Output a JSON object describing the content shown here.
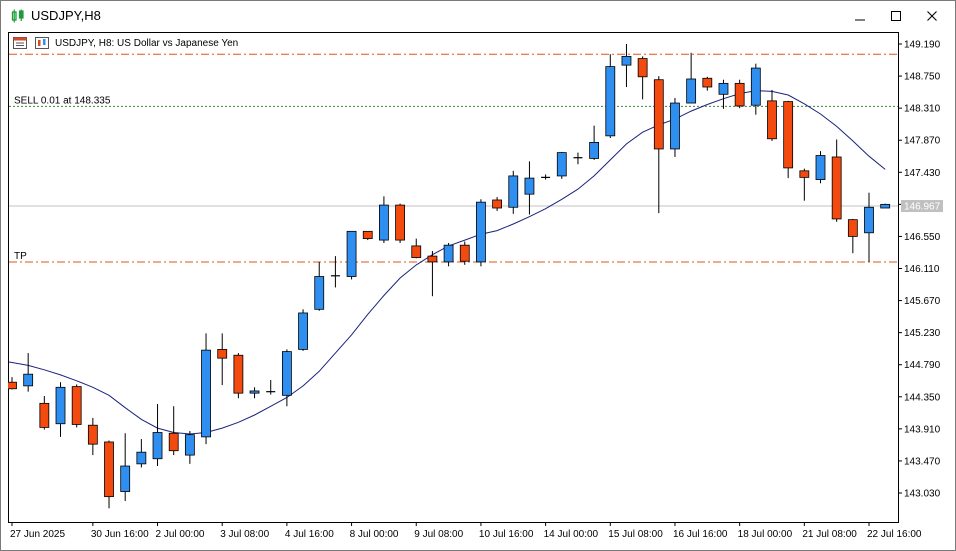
{
  "window": {
    "title": "USDJPY,H8",
    "icons": {
      "app": "chart-bars-icon",
      "minimize": "minimize-icon",
      "maximize": "maximize-icon",
      "close": "close-icon"
    }
  },
  "chart_header": {
    "symbol_label": "USDJPY, H8:  US Dollar vs Japanese Yen",
    "icons": [
      "data-window-icon",
      "chart-type-icon"
    ]
  },
  "colors": {
    "bull": "#2e8ff0",
    "bear": "#f24a0f",
    "ma": "#1a237e",
    "order_line": "#e2571d",
    "sell_line": "#3a8a3a",
    "bid_line": "#c0c0c0"
  },
  "lines": {
    "sell_label": "SELL 0.01 at 148.335",
    "sell_price": 148.335,
    "tp_label": "TP",
    "tp_price": 146.2,
    "upper_order_price": 149.05,
    "bid_price": 146.967,
    "bid_label": "146.967"
  },
  "chart_data": {
    "type": "candlestick",
    "title": "USDJPY, H8:  US Dollar vs Japanese Yen",
    "xlabel": "",
    "ylabel": "",
    "ylim": [
      142.62,
      149.43
    ],
    "y_ticks": [
      "149.190",
      "148.750",
      "148.310",
      "147.870",
      "147.430",
      "146.990",
      "146.550",
      "146.110",
      "145.670",
      "145.230",
      "144.790",
      "144.350",
      "143.910",
      "143.470",
      "143.030"
    ],
    "y_tick_values": [
      149.19,
      148.75,
      148.31,
      147.87,
      147.43,
      146.99,
      146.55,
      146.11,
      145.67,
      145.23,
      144.79,
      144.35,
      143.91,
      143.47,
      143.03
    ],
    "x_labels": [
      {
        "label": "27 Jun 2025",
        "index": 0
      },
      {
        "label": "30 Jun 16:00",
        "index": 5
      },
      {
        "label": "2 Jul 00:00",
        "index": 9
      },
      {
        "label": "3 Jul 08:00",
        "index": 13
      },
      {
        "label": "4 Jul 16:00",
        "index": 17
      },
      {
        "label": "8 Jul 00:00",
        "index": 21
      },
      {
        "label": "9 Jul 08:00",
        "index": 25
      },
      {
        "label": "10 Jul 16:00",
        "index": 29
      },
      {
        "label": "14 Jul 00:00",
        "index": 33
      },
      {
        "label": "15 Jul 08:00",
        "index": 37
      },
      {
        "label": "16 Jul 16:00",
        "index": 41
      },
      {
        "label": "18 Jul 00:00",
        "index": 45
      },
      {
        "label": "21 Jul 08:00",
        "index": 49
      },
      {
        "label": "22 Jul 16:00",
        "index": 53
      }
    ],
    "candles": [
      {
        "o": 144.55,
        "h": 144.62,
        "l": 144.45,
        "c": 144.46
      },
      {
        "o": 144.5,
        "h": 144.95,
        "l": 144.42,
        "c": 144.66
      },
      {
        "o": 144.26,
        "h": 144.36,
        "l": 143.9,
        "c": 143.93
      },
      {
        "o": 143.98,
        "h": 144.55,
        "l": 143.8,
        "c": 144.48
      },
      {
        "o": 144.49,
        "h": 144.52,
        "l": 143.93,
        "c": 143.97
      },
      {
        "o": 143.96,
        "h": 144.06,
        "l": 143.55,
        "c": 143.7
      },
      {
        "o": 143.73,
        "h": 143.75,
        "l": 142.82,
        "c": 142.98
      },
      {
        "o": 143.05,
        "h": 143.85,
        "l": 142.92,
        "c": 143.4
      },
      {
        "o": 143.43,
        "h": 143.77,
        "l": 143.38,
        "c": 143.59
      },
      {
        "o": 143.5,
        "h": 144.25,
        "l": 143.4,
        "c": 143.86
      },
      {
        "o": 143.85,
        "h": 144.22,
        "l": 143.55,
        "c": 143.61
      },
      {
        "o": 143.55,
        "h": 143.88,
        "l": 143.43,
        "c": 143.83
      },
      {
        "o": 143.8,
        "h": 145.22,
        "l": 143.7,
        "c": 144.99
      },
      {
        "o": 145.0,
        "h": 145.22,
        "l": 144.51,
        "c": 144.88
      },
      {
        "o": 144.92,
        "h": 144.95,
        "l": 144.33,
        "c": 144.4
      },
      {
        "o": 144.4,
        "h": 144.48,
        "l": 144.33,
        "c": 144.43
      },
      {
        "o": 144.42,
        "h": 144.58,
        "l": 144.38,
        "c": 144.42
      },
      {
        "o": 144.37,
        "h": 145.0,
        "l": 144.22,
        "c": 144.97
      },
      {
        "o": 145.0,
        "h": 145.55,
        "l": 144.98,
        "c": 145.5
      },
      {
        "o": 145.55,
        "h": 146.2,
        "l": 145.53,
        "c": 146.0
      },
      {
        "o": 146.0,
        "h": 146.28,
        "l": 145.85,
        "c": 146.01
      },
      {
        "o": 146.0,
        "h": 146.62,
        "l": 145.96,
        "c": 146.62
      },
      {
        "o": 146.62,
        "h": 146.62,
        "l": 146.5,
        "c": 146.52
      },
      {
        "o": 146.5,
        "h": 147.1,
        "l": 146.46,
        "c": 146.98
      },
      {
        "o": 146.98,
        "h": 147.0,
        "l": 146.46,
        "c": 146.5
      },
      {
        "o": 146.42,
        "h": 146.52,
        "l": 146.25,
        "c": 146.26
      },
      {
        "o": 146.28,
        "h": 146.35,
        "l": 145.73,
        "c": 146.2
      },
      {
        "o": 146.2,
        "h": 146.46,
        "l": 146.14,
        "c": 146.43
      },
      {
        "o": 146.43,
        "h": 146.48,
        "l": 146.16,
        "c": 146.21
      },
      {
        "o": 146.2,
        "h": 147.06,
        "l": 146.14,
        "c": 147.02
      },
      {
        "o": 147.05,
        "h": 147.09,
        "l": 146.9,
        "c": 146.94
      },
      {
        "o": 146.95,
        "h": 147.45,
        "l": 146.86,
        "c": 147.38
      },
      {
        "o": 147.13,
        "h": 147.58,
        "l": 146.85,
        "c": 147.35
      },
      {
        "o": 147.36,
        "h": 147.4,
        "l": 147.33,
        "c": 147.36
      },
      {
        "o": 147.38,
        "h": 147.71,
        "l": 147.34,
        "c": 147.7
      },
      {
        "o": 147.63,
        "h": 147.7,
        "l": 147.54,
        "c": 147.63
      },
      {
        "o": 147.62,
        "h": 148.07,
        "l": 147.6,
        "c": 147.84
      },
      {
        "o": 147.93,
        "h": 149.05,
        "l": 147.9,
        "c": 148.88
      },
      {
        "o": 148.9,
        "h": 149.19,
        "l": 148.6,
        "c": 149.02
      },
      {
        "o": 148.99,
        "h": 149.02,
        "l": 148.43,
        "c": 148.74
      },
      {
        "o": 148.7,
        "h": 148.75,
        "l": 146.87,
        "c": 147.75
      },
      {
        "o": 147.75,
        "h": 148.45,
        "l": 147.64,
        "c": 148.38
      },
      {
        "o": 148.38,
        "h": 149.07,
        "l": 148.38,
        "c": 148.71
      },
      {
        "o": 148.72,
        "h": 148.74,
        "l": 148.55,
        "c": 148.6
      },
      {
        "o": 148.5,
        "h": 148.7,
        "l": 148.3,
        "c": 148.65
      },
      {
        "o": 148.65,
        "h": 148.7,
        "l": 148.31,
        "c": 148.34
      },
      {
        "o": 148.35,
        "h": 148.92,
        "l": 148.22,
        "c": 148.86
      },
      {
        "o": 148.41,
        "h": 148.56,
        "l": 147.86,
        "c": 147.89
      },
      {
        "o": 148.4,
        "h": 148.41,
        "l": 147.35,
        "c": 147.49
      },
      {
        "o": 147.45,
        "h": 147.48,
        "l": 147.04,
        "c": 147.36
      },
      {
        "o": 147.33,
        "h": 147.72,
        "l": 147.28,
        "c": 147.66
      },
      {
        "o": 147.64,
        "h": 147.88,
        "l": 146.75,
        "c": 146.79
      },
      {
        "o": 146.78,
        "h": 146.79,
        "l": 146.32,
        "c": 146.55
      },
      {
        "o": 146.6,
        "h": 147.15,
        "l": 146.2,
        "c": 146.95
      },
      {
        "o": 146.94,
        "h": 147.0,
        "l": 146.94,
        "c": 146.99
      }
    ],
    "ma_series": {
      "start_index": -1,
      "values": [
        144.86,
        144.82,
        144.78,
        144.72,
        144.65,
        144.57,
        144.48,
        144.37,
        144.2,
        144.04,
        143.92,
        143.86,
        143.84,
        143.86,
        143.92,
        144.0,
        144.1,
        144.22,
        144.34,
        144.5,
        144.7,
        144.95,
        145.2,
        145.48,
        145.74,
        145.98,
        146.16,
        146.3,
        146.42,
        146.5,
        146.58,
        146.63,
        146.72,
        146.82,
        146.93,
        147.06,
        147.2,
        147.38,
        147.6,
        147.82,
        147.98,
        148.08,
        148.16,
        148.27,
        148.36,
        148.44,
        148.51,
        148.55,
        148.54,
        148.49,
        148.37,
        148.23,
        148.06,
        147.86,
        147.65,
        147.47
      ]
    }
  }
}
